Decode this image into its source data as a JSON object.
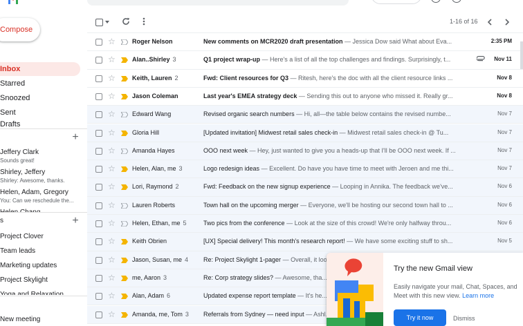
{
  "sidebar": {
    "compose_label": "Compose",
    "nav": [
      {
        "label": "Inbox",
        "active": true
      },
      {
        "label": "Starred"
      },
      {
        "label": "Snoozed"
      },
      {
        "label": "Sent"
      },
      {
        "label": "Drafts"
      }
    ],
    "chats": [
      {
        "name": "Jeffery Clark",
        "preview": "Sounds great!"
      },
      {
        "name": "Shirley, Jeffery",
        "preview": "Shirley: Awesome, thanks."
      },
      {
        "name": "Helen, Adam, Gregory",
        "preview": "You: Can we reschedule the..."
      },
      {
        "name": "Helen Chang",
        "preview": ""
      }
    ],
    "spaces_header": "s",
    "labels": [
      "Project Clover",
      "Team leads",
      "Marketing updates",
      "Project Skylight",
      "Yoga and Relaxation"
    ],
    "new_meeting": "New meeting"
  },
  "toolbar": {
    "pagination": "1-16 of 16"
  },
  "emails": [
    {
      "sender": "Roger Nelson",
      "count": "",
      "subject": "New comments on MCR2020 draft presentation",
      "snippet": " — Jessica Dow said What about Eva...",
      "date": "2:35 PM",
      "unread": true,
      "important": false,
      "attachment": false
    },
    {
      "sender": "Alan..Shirley",
      "count": "3",
      "subject": "Q1 project wrap-up",
      "snippet": " — Here's a list of all the top challenges and findings. Surprisingly, t...",
      "date": "Nov 11",
      "unread": true,
      "important": true,
      "attachment": true
    },
    {
      "sender": "Keith, Lauren",
      "count": "2",
      "subject": "Fwd: Client resources for Q3",
      "snippet": " — Ritesh, here's the doc with all the client resource links ...",
      "date": "Nov 8",
      "unread": true,
      "important": true,
      "attachment": false
    },
    {
      "sender": "Jason Coleman",
      "count": "",
      "subject": "Last year's EMEA strategy deck",
      "snippet": " — Sending this out to anyone who missed it. Really gr...",
      "date": "Nov 8",
      "unread": true,
      "important": true,
      "attachment": false
    },
    {
      "sender": "Edward Wang",
      "count": "",
      "subject": "Revised organic search numbers",
      "snippet": " — Hi, all—the table below contains the revised numbe...",
      "date": "Nov 7",
      "unread": false,
      "important": false,
      "attachment": false
    },
    {
      "sender": "Gloria Hill",
      "count": "",
      "subject": "[Updated invitation] Midwest retail sales check-in",
      "snippet": " — Midwest retail sales check-in @ Tu...",
      "date": "Nov 7",
      "unread": false,
      "important": true,
      "attachment": false
    },
    {
      "sender": "Amanda Hayes",
      "count": "",
      "subject": "OOO next week",
      "snippet": " — Hey, just wanted to give you a heads-up that I'll be OOO next week. If ...",
      "date": "Nov 7",
      "unread": false,
      "important": false,
      "attachment": false
    },
    {
      "sender": "Helen, Alan, me",
      "count": "3",
      "subject": "Logo redesign ideas",
      "snippet": " — Excellent. Do have you have time to meet with Jeroen and me thi...",
      "date": "Nov 7",
      "unread": false,
      "important": true,
      "attachment": false
    },
    {
      "sender": "Lori, Raymond",
      "count": "2",
      "subject": "Fwd: Feedback on the new signup experience",
      "snippet": " — Looping in Annika. The feedback we've...",
      "date": "Nov 6",
      "unread": false,
      "important": true,
      "attachment": false
    },
    {
      "sender": "Lauren Roberts",
      "count": "",
      "subject": "Town hall on the upcoming merger",
      "snippet": " — Everyone, we'll be hosting our second town hall to ...",
      "date": "Nov 6",
      "unread": false,
      "important": false,
      "attachment": false
    },
    {
      "sender": "Helen, Ethan, me",
      "count": "5",
      "subject": "Two pics from the conference",
      "snippet": " — Look at the size of this crowd! We're only halfway throu...",
      "date": "Nov 6",
      "unread": false,
      "important": false,
      "attachment": false
    },
    {
      "sender": "Keith Obrien",
      "count": "",
      "subject": "[UX] Special delivery! This month's research report!",
      "snippet": " — We have some exciting stuff to sh...",
      "date": "Nov 5",
      "unread": false,
      "important": true,
      "attachment": false
    },
    {
      "sender": "Jason, Susan, me",
      "count": "4",
      "subject": "Re: Project Skylight 1-pager",
      "snippet": " — Overall, it look...",
      "date": "",
      "unread": false,
      "important": true,
      "attachment": false
    },
    {
      "sender": "me, Aaron",
      "count": "3",
      "subject": "Re: Corp strategy slides?",
      "snippet": " — Awesome, tha...",
      "date": "",
      "unread": false,
      "important": true,
      "attachment": false
    },
    {
      "sender": "Alan, Adam",
      "count": "6",
      "subject": "Updated expense report template",
      "snippet": " — It's he...",
      "date": "",
      "unread": false,
      "important": true,
      "attachment": false
    },
    {
      "sender": "Amanda, me, Tom",
      "count": "3",
      "subject": "Referrals from Sydney — need input",
      "snippet": " — Ashl...",
      "date": "",
      "unread": false,
      "important": true,
      "attachment": false
    }
  ],
  "promo": {
    "title": "Try the new Gmail view",
    "body": "Easily navigate your mail, Chat, Spaces, and Meet with this new view.",
    "learn_more": "Learn more",
    "try_label": "Try it now",
    "dismiss_label": "Dismiss"
  },
  "colors": {
    "important_marker": "#f4b400",
    "accent_red": "#d93025",
    "accent_blue": "#1a73e8"
  }
}
